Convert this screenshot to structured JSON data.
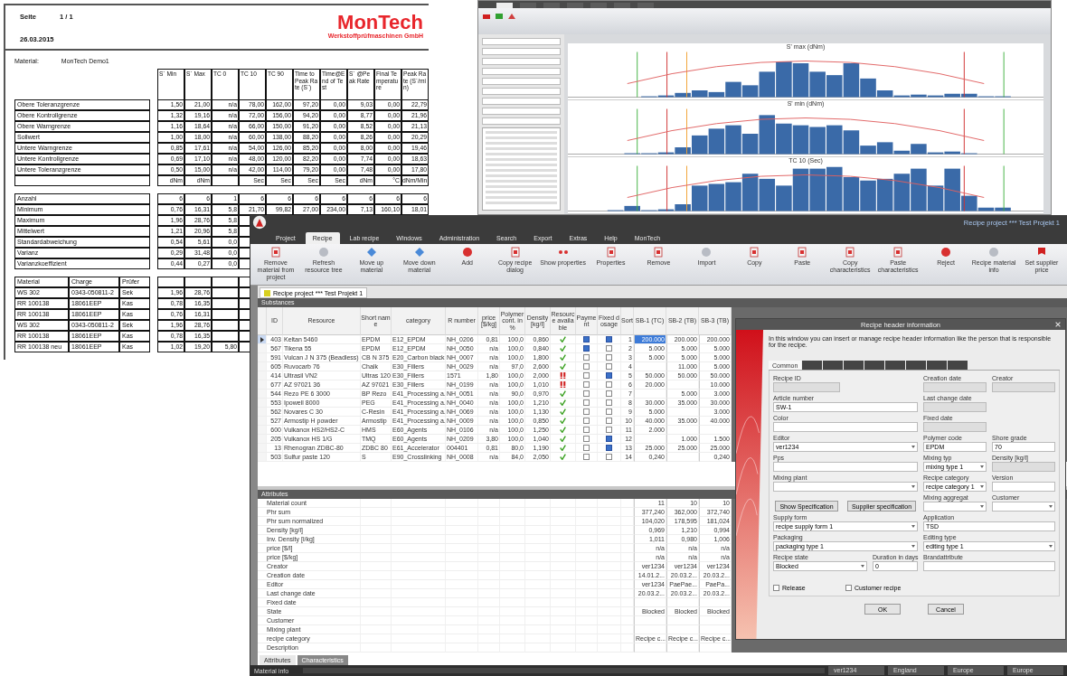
{
  "report": {
    "page_label": "Seite",
    "page": "1 / 1",
    "date": "26.03.2015",
    "logo": {
      "name": "MonTech",
      "subtitle": "Werkstoffprüfmaschinen GmbH"
    },
    "material_label": "Material:",
    "material": "MonTech Demo1",
    "columns": [
      {
        "label": "S´ Min",
        "unit": "dNm"
      },
      {
        "label": "S´ Max",
        "unit": "dNm"
      },
      {
        "label": "TC  0"
      },
      {
        "label": "TC 10",
        "unit": "Sec"
      },
      {
        "label": "TC 90",
        "unit": "Sec"
      },
      {
        "label": "Time to Peak Rate (S´)",
        "unit": "Sec"
      },
      {
        "label": "Time@End of Test",
        "unit": "Sec"
      },
      {
        "label": "S´ @Peak Rate",
        "unit": "dNm"
      },
      {
        "label": "Final Temperature",
        "unit": "°C"
      },
      {
        "label": "Peak Rate (S´/min)",
        "unit": "dNm/Min"
      }
    ],
    "limits": [
      {
        "label": "Obere Toleranzgrenze",
        "values": [
          "1,50",
          "21,00",
          "n/a",
          "78,00",
          "162,00",
          "97,20",
          "0,00",
          "9,03",
          "0,00",
          "22,79"
        ]
      },
      {
        "label": "Obere Kontrollgrenze",
        "values": [
          "1,32",
          "19,16",
          "n/a",
          "72,00",
          "156,00",
          "94,20",
          "0,00",
          "8,77",
          "0,00",
          "21,96"
        ]
      },
      {
        "label": "Obere Warngrenze",
        "values": [
          "1,16",
          "18,64",
          "n/a",
          "66,00",
          "150,00",
          "91,20",
          "0,00",
          "8,52",
          "0,00",
          "21,13"
        ]
      },
      {
        "label": "Sollwert",
        "values": [
          "1,00",
          "18,00",
          "n/a",
          "60,00",
          "138,00",
          "88,20",
          "0,00",
          "8,26",
          "0,00",
          "20,29"
        ]
      },
      {
        "label": "Untere Warngrenze",
        "values": [
          "0,85",
          "17,61",
          "n/a",
          "54,00",
          "126,00",
          "85,20",
          "0,00",
          "8,00",
          "0,00",
          "19,46"
        ]
      },
      {
        "label": "Untere Kontrollgrenze",
        "values": [
          "0,69",
          "17,10",
          "n/a",
          "48,00",
          "120,00",
          "82,20",
          "0,00",
          "7,74",
          "0,00",
          "18,63"
        ]
      },
      {
        "label": "Untere Toleranzgrenze",
        "values": [
          "0,50",
          "15,00",
          "n/a",
          "42,00",
          "114,00",
          "79,20",
          "0,00",
          "7,48",
          "0,00",
          "17,80"
        ]
      }
    ],
    "statistics": [
      {
        "label": "Anzahl",
        "values": [
          "6",
          "6",
          "1",
          "6",
          "6",
          "6",
          "6",
          "6",
          "6",
          "6"
        ]
      },
      {
        "label": "Minimum",
        "values": [
          "0,76",
          "16,31",
          "5,8",
          "21,70",
          "99,82",
          "27,00",
          "234,00",
          "7,13",
          "160,10",
          "18,01"
        ]
      },
      {
        "label": "Maximum",
        "values": [
          "1,96",
          "28,76",
          "5,8"
        ]
      },
      {
        "label": "Mittelwert",
        "values": [
          "1,21",
          "20,96",
          "5,8"
        ]
      },
      {
        "label": "Standardabweichung",
        "values": [
          "0,54",
          "5,61",
          "0,0"
        ]
      },
      {
        "label": "Varianz",
        "values": [
          "0,29",
          "31,48",
          "0,0"
        ]
      },
      {
        "label": "Varianzkoeffizient",
        "values": [
          "0,44",
          "0,27",
          "0,0"
        ]
      }
    ],
    "samples": {
      "columns": [
        "Material",
        "Charge",
        "Prüfer"
      ],
      "rows": [
        {
          "cells": [
            "WS 302",
            "0343-050811-2",
            "Sek"
          ],
          "values": [
            "1,96",
            "28,76"
          ]
        },
        {
          "cells": [
            "RR 100138",
            "18061EEP",
            "Kas"
          ],
          "values": [
            "0,78",
            "16,35"
          ]
        },
        {
          "cells": [
            "RR 100138",
            "18061EEP",
            "Kas"
          ],
          "values": [
            "0,76",
            "16,31"
          ]
        },
        {
          "cells": [
            "WS 302",
            "0343-050811-2",
            "Sek"
          ],
          "values": [
            "1,96",
            "28,76"
          ]
        },
        {
          "cells": [
            "RR 100138",
            "18061EEP",
            "Kas"
          ],
          "values": [
            "0,78",
            "16,35"
          ]
        },
        {
          "cells": [
            "RR 100138 neu",
            "18061EEP",
            "Kas"
          ],
          "values": [
            "1,02",
            "19,20",
            "5,80"
          ]
        }
      ]
    }
  },
  "chart_window": {
    "tabs": [
      {
        "selected": true
      },
      {
        "selected": false
      },
      {
        "selected": false
      },
      {
        "selected": false
      },
      {
        "selected": false
      },
      {
        "selected": false
      },
      {
        "selected": false
      }
    ],
    "charts": [
      {
        "title": "S' max (dNm)"
      },
      {
        "title": "S' min (dNm)"
      },
      {
        "title": "TC 10 (Sec)"
      }
    ]
  },
  "main_window": {
    "title": "Recipe project *** Test Projekt 1",
    "menu": [
      {
        "label": "Project",
        "selected": false
      },
      {
        "label": "Recipe",
        "selected": true
      },
      {
        "label": "Lab recipe",
        "selected": false
      },
      {
        "label": "Windows",
        "selected": false
      },
      {
        "label": "Administration",
        "selected": false
      },
      {
        "label": "Search",
        "selected": false
      },
      {
        "label": "Export",
        "selected": false
      },
      {
        "label": "Extras",
        "selected": false
      },
      {
        "label": "Help",
        "selected": false
      },
      {
        "label": "MonTech",
        "selected": false
      }
    ],
    "toolbar": [
      "Remove material from project",
      "Refresh resource tree",
      "Move up material",
      "Move down material",
      "Add",
      "Copy recipe dialog",
      "Show properties",
      "Properties",
      "Remove",
      "Import",
      "Copy",
      "Paste",
      "Copy characteristics",
      "Paste characteristics",
      "Reject",
      "Recipe material info",
      "Set supplier price"
    ],
    "document_tab": "Recipe project *** Test Projekt 1",
    "substances": {
      "title": "Substances",
      "columns": [
        "ID",
        "Resource",
        "Short name",
        "category",
        "R number",
        "price [$/kg]",
        "Polymer cont. in %",
        "Density [kg/l]",
        "Resource available",
        "Payment",
        "Fixed dosage",
        "Sort",
        "SB-1 (TC)",
        "SB-2 (TB)",
        "SB-3 (TB)"
      ],
      "rows": [
        {
          "id": "403",
          "resource": "Keltan 5460",
          "short_name": "EPDM",
          "category": "E12_EPDM",
          "r_number": "NH_0206",
          "price": "0,81",
          "polymer": "100,0",
          "density": "0,860",
          "available": true,
          "pay": true,
          "fixed": true,
          "sort": "1",
          "bb": {
            "sb_1": "200.000",
            "sb_2": "200.000",
            "sb_3": "200.000"
          },
          "selected": true
        },
        {
          "id": "567",
          "resource": "Tikena 55",
          "short_name": "EPDM",
          "category": "E12_EPDM",
          "r_number": "NH_0050",
          "price": "n/a",
          "polymer": "100,0",
          "density": "0,840",
          "available": true,
          "pay": true,
          "fixed": false,
          "sort": "2",
          "bb": {
            "sb_1": "5.000",
            "sb_2": "5.000",
            "sb_3": "5.000"
          },
          "selected": false
        },
        {
          "id": "591",
          "resource": "Vulcan J N 375 (Beadless)",
          "short_name": "CB N 375",
          "category": "E20_Carbon black",
          "r_number": "NH_0007",
          "price": "n/a",
          "polymer": "100,0",
          "density": "1,800",
          "available": true,
          "pay": false,
          "fixed": false,
          "sort": "3",
          "bb": {
            "sb_1": "5.000",
            "sb_2": "5.000",
            "sb_3": "5.000"
          },
          "selected": false
        },
        {
          "id": "605",
          "resource": "Ruvocarb 76",
          "short_name": "Chalk",
          "category": "E30_Fillers",
          "r_number": "NH_0029",
          "price": "n/a",
          "polymer": "97,0",
          "density": "2,600",
          "available": true,
          "pay": false,
          "fixed": false,
          "sort": "4",
          "bb": {
            "sb_2": "11.000",
            "sb_3": "5.000"
          },
          "selected": false
        },
        {
          "id": "414",
          "resource": "Ultrasil VN2",
          "short_name": "Ultras 120",
          "category": "E30_Fillers",
          "r_number": "1571",
          "price": "1,80",
          "polymer": "100,0",
          "density": "2,000",
          "available": false,
          "pay": false,
          "fixed": true,
          "sort": "5",
          "bb": {
            "sb_1": "50.000",
            "sb_2": "50.000",
            "sb_3": "50.000"
          },
          "selected": false
        },
        {
          "id": "677",
          "resource": "AZ 97021 36",
          "short_name": "AZ 97021",
          "category": "E30_Fillers",
          "r_number": "NH_0199",
          "price": "n/a",
          "polymer": "100,0",
          "density": "1,010",
          "available": false,
          "pay": false,
          "fixed": false,
          "sort": "6",
          "bb": {
            "sb_1": "20.000",
            "sb_3": "10.000"
          },
          "selected": false
        },
        {
          "id": "544",
          "resource": "Rezo PE 6 3000",
          "short_name": "BP Rezo",
          "category": "E41_Processing a.",
          "r_number": "NH_0051",
          "price": "n/a",
          "polymer": "90,0",
          "density": "0,970",
          "available": true,
          "pay": false,
          "fixed": false,
          "sort": "7",
          "bb": {
            "sb_2": "5.000",
            "sb_3": "3.000"
          },
          "selected": false
        },
        {
          "id": "553",
          "resource": "Ipowell 8000",
          "short_name": "PEG",
          "category": "E41_Processing a.",
          "r_number": "NH_0040",
          "price": "n/a",
          "polymer": "100,0",
          "density": "1,210",
          "available": true,
          "pay": false,
          "fixed": false,
          "sort": "8",
          "bb": {
            "sb_1": "30.000",
            "sb_2": "35.000",
            "sb_3": "30.000"
          },
          "selected": false
        },
        {
          "id": "562",
          "resource": "Novares C 30",
          "short_name": "C-Resin",
          "category": "E41_Processing a.",
          "r_number": "NH_0069",
          "price": "n/a",
          "polymer": "100,0",
          "density": "1,130",
          "available": true,
          "pay": false,
          "fixed": false,
          "sort": "9",
          "bb": {
            "sb_1": "5.000",
            "sb_3": "3.000"
          },
          "selected": false
        },
        {
          "id": "527",
          "resource": "Armostip H powder",
          "short_name": "Armostip",
          "category": "E41_Processing a.",
          "r_number": "NH_0009",
          "price": "n/a",
          "polymer": "100,0",
          "density": "0,850",
          "available": true,
          "pay": false,
          "fixed": false,
          "sort": "10",
          "bb": {
            "sb_1": "40.000",
            "sb_2": "35.000",
            "sb_3": "40.000"
          },
          "selected": false
        },
        {
          "id": "600",
          "resource": "Vulkanox HS2/HS2-C",
          "short_name": "HMS",
          "category": "E60_Agents",
          "r_number": "NH_0106",
          "price": "n/a",
          "polymer": "100,0",
          "density": "1,250",
          "available": true,
          "pay": false,
          "fixed": false,
          "sort": "11",
          "bb": {
            "sb_1": "2.000"
          },
          "selected": false
        },
        {
          "id": "205",
          "resource": "Vulkanox HS 1/G",
          "short_name": "TMQ",
          "category": "E60_Agents",
          "r_number": "NH_0209",
          "price": "3,80",
          "polymer": "100,0",
          "density": "1,040",
          "available": true,
          "pay": false,
          "fixed": true,
          "sort": "12",
          "bb": {
            "sb_2": "1.000",
            "sb_3": "1.500"
          },
          "selected": false
        },
        {
          "id": "13",
          "resource": "Rhenogran ZDBC-80",
          "short_name": "ZDBC 80",
          "category": "E61_Accelerator",
          "r_number": "004401",
          "price": "0,81",
          "polymer": "80,0",
          "density": "1,190",
          "available": true,
          "pay": false,
          "fixed": true,
          "sort": "13",
          "bb": {
            "sb_1": "25.000",
            "sb_2": "25.000",
            "sb_3": "25.000"
          },
          "selected": false
        },
        {
          "id": "503",
          "resource": "Sulfur paste 120",
          "short_name": "S",
          "category": "E90_Crosslinking",
          "r_number": "NH_0008",
          "price": "n/a",
          "polymer": "84,0",
          "density": "2,050",
          "available": true,
          "pay": false,
          "fixed": false,
          "sort": "14",
          "bb": {
            "sb_1": "0,240",
            "sb_3": "0,240"
          },
          "selected": false
        }
      ]
    },
    "attributes": {
      "title": "Attributes",
      "rows": [
        {
          "label": "Material count",
          "values": [
            "11",
            "10",
            "10"
          ]
        },
        {
          "label": "Phr sum",
          "values": [
            "377,240",
            "362,000",
            "372,740"
          ]
        },
        {
          "label": "Phr sum normalized",
          "values": [
            "104,020",
            "178,595",
            "181,024"
          ]
        },
        {
          "label": "Density [kg/l]",
          "values": [
            "0,969",
            "1,210",
            "0,994"
          ]
        },
        {
          "label": "Inv. Density [l/kg]",
          "values": [
            "1,011",
            "0,980",
            "1,006"
          ]
        },
        {
          "label": "price [$/l]",
          "values": [
            "n/a",
            "n/a",
            "n/a"
          ]
        },
        {
          "label": "price [$/kg]",
          "values": [
            "n/a",
            "n/a",
            "n/a"
          ]
        },
        {
          "label": "Creator",
          "values": [
            "ver1234",
            "ver1234",
            "ver1234"
          ]
        },
        {
          "label": "Creation date",
          "values": [
            "14.01.2...",
            "20.03.2...",
            "20.03.2..."
          ]
        },
        {
          "label": "Editor",
          "values": [
            "ver1234",
            "PaePae...",
            "PaePa..."
          ]
        },
        {
          "label": "Last change date",
          "values": [
            "20.03.2...",
            "20.03.2...",
            "20.03.2..."
          ]
        },
        {
          "label": "Fixed date",
          "values": []
        },
        {
          "label": "State",
          "values": [
            "Blocked",
            "Blocked",
            "Blocked"
          ]
        },
        {
          "label": "Customer",
          "values": []
        },
        {
          "label": "Mixing plant",
          "values": []
        },
        {
          "label": "recipe category",
          "values": [
            "Recipe c...",
            "Recipe c...",
            "Recipe c..."
          ]
        },
        {
          "label": "Description",
          "values": []
        }
      ]
    },
    "bottom_tabs": [
      {
        "label": "Attributes",
        "selected": true
      },
      {
        "label": "Characteristics",
        "selected": false
      }
    ],
    "status_bar": {
      "left": "Material info",
      "items": [
        "ver1234",
        "England",
        "Europe",
        "Europe"
      ]
    }
  },
  "dialog": {
    "title": "Recipe header information",
    "description": "In this window you can insert or manage recipe header information like the person that is responsible for the recipe.",
    "tabs": [
      {
        "label": "Common",
        "selected": true
      },
      {
        "selected": false
      },
      {
        "selected": false
      },
      {
        "selected": false
      },
      {
        "selected": false
      },
      {
        "selected": false
      },
      {
        "selected": false
      },
      {
        "selected": false
      },
      {
        "selected": false
      }
    ],
    "fields": [
      {
        "kind": "text",
        "label": "Recipe ID",
        "disabled": true
      },
      {
        "kind": "text",
        "label": "Creation date",
        "disabled": true
      },
      {
        "kind": "text",
        "label": "Creator",
        "disabled": true
      },
      {
        "kind": "text",
        "label": "Article number",
        "value": "SW-1",
        "disabled": false
      },
      {
        "kind": "text",
        "label": "Last change date",
        "disabled": true
      },
      {
        "kind": "text",
        "label": "Color",
        "disabled": false
      },
      {
        "kind": "text",
        "label": "Fixed date",
        "disabled": true
      },
      {
        "kind": "select",
        "label": "Editor",
        "value": "ver1234",
        "disabled": false
      },
      {
        "kind": "text",
        "label": "Polymer code",
        "value": "EPDM",
        "disabled": false
      },
      {
        "kind": "text",
        "label": "Shore grade",
        "value": "70",
        "disabled": false
      },
      {
        "kind": "text",
        "label": "Pps",
        "disabled": false
      },
      {
        "kind": "select",
        "label": "Mixing typ",
        "value": "mixing type 1",
        "disabled": false
      },
      {
        "kind": "text",
        "label": "Density [kg/l]",
        "disabled": true
      },
      {
        "kind": "select",
        "label": "Mixing plant",
        "disabled": false
      },
      {
        "kind": "select",
        "label": "Recipe category",
        "value": "recipe category 1",
        "disabled": false
      },
      {
        "kind": "text",
        "label": "Version",
        "disabled": false
      },
      {
        "kind": "button",
        "label": "Show Specification"
      },
      {
        "kind": "button",
        "label": "Supplier specification"
      },
      {
        "kind": "select",
        "label": "Mixing aggregat",
        "disabled": false
      },
      {
        "kind": "select",
        "label": "Customer",
        "disabled": false
      },
      {
        "kind": "select",
        "label": "Supply form",
        "value": "recipe supply form 1",
        "disabled": false
      },
      {
        "kind": "text",
        "label": "Application",
        "value": "TSD",
        "disabled": false
      },
      {
        "kind": "select",
        "label": "Packaging",
        "value": "packaging type 1",
        "disabled": false
      },
      {
        "kind": "select",
        "label": "Editing type",
        "value": "editing type 1",
        "disabled": false
      },
      {
        "kind": "select",
        "label": "Recipe state",
        "value": "Blocked",
        "disabled": false
      },
      {
        "kind": "text",
        "label": "Duration in days",
        "value": "0",
        "disabled": false
      },
      {
        "kind": "text",
        "label": "Brandattribute",
        "disabled": false
      },
      {
        "kind": "check",
        "label": "Release",
        "checked": false
      },
      {
        "kind": "check",
        "label": "Customer recipe",
        "checked": false
      }
    ],
    "buttons": [
      "OK",
      "Cancel"
    ]
  }
}
